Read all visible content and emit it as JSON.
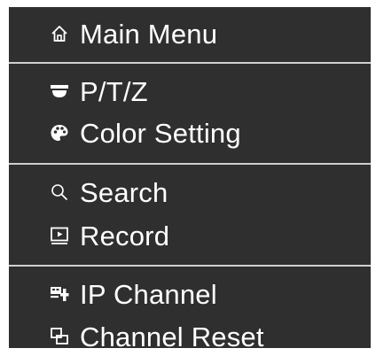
{
  "menu": {
    "items": [
      {
        "label": "Main Menu",
        "icon": "home-icon"
      },
      {
        "label": "P/T/Z",
        "icon": "dome-camera-icon"
      },
      {
        "label": "Color Setting",
        "icon": "palette-icon"
      },
      {
        "label": "Search",
        "icon": "search-icon"
      },
      {
        "label": "Record",
        "icon": "record-play-icon"
      },
      {
        "label": "IP Channel",
        "icon": "ip-channel-icon"
      },
      {
        "label": "Channel Reset",
        "icon": "channel-reset-icon"
      }
    ]
  },
  "colors": {
    "background": "#2f2f2f",
    "text": "#ffffff",
    "divider": "#d0d0d0"
  }
}
